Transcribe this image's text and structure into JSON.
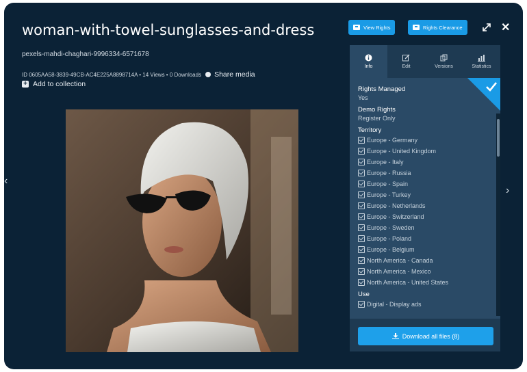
{
  "header": {
    "title": "woman-with-towel-sunglasses-and-dress",
    "filename": "pexels-mahdi-chaghari-9996334-6571678",
    "meta": "ID 0605AA58-3839-49CB-AC4E225A8898714A • 14 Views • 0 Downloads",
    "share_label": "Share media",
    "add_collection_label": "Add to collection"
  },
  "toolbar": {
    "view_rights_label": "View Rights",
    "rights_clearance_label": "Rights Clearance"
  },
  "panel": {
    "tabs": [
      {
        "label": "Info",
        "icon": "info-icon"
      },
      {
        "label": "Edit",
        "icon": "edit-icon"
      },
      {
        "label": "Versions",
        "icon": "versions-icon"
      },
      {
        "label": "Statistics",
        "icon": "statistics-icon"
      }
    ],
    "rights_managed_label": "Rights Managed",
    "rights_managed_value": "Yes",
    "demo_rights_label": "Demo Rights",
    "demo_rights_value": "Register Only",
    "territory_label": "Territory",
    "territories": [
      "Europe - Germany",
      "Europe - United Kingdom",
      "Europe - Italy",
      "Europe - Russia",
      "Europe - Spain",
      "Europe - Turkey",
      "Europe - Netherlands",
      "Europe - Switzerland",
      "Europe - Sweden",
      "Europe - Poland",
      "Europe - Belgium",
      "North America - Canada",
      "North America - Mexico",
      "North America - United States"
    ],
    "use_label": "Use",
    "uses": [
      "Digital - Display ads"
    ],
    "download_label": "Download all files (8)"
  },
  "colors": {
    "background": "#0b2236",
    "panel": "#2a4a66",
    "accent": "#1a9be6"
  }
}
